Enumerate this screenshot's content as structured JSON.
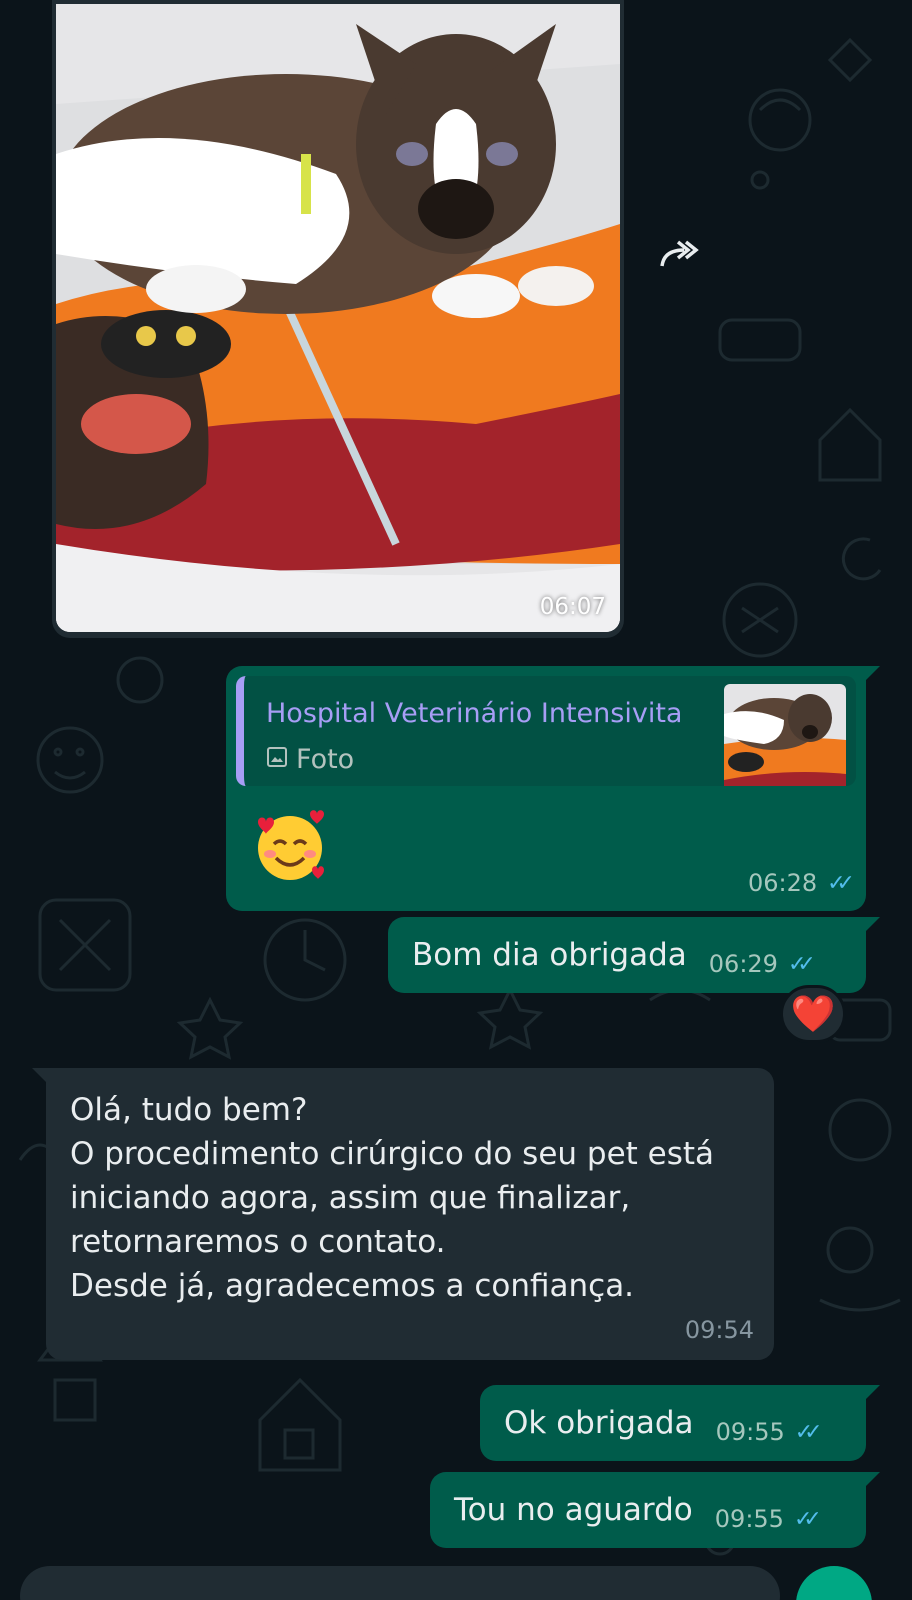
{
  "messages": {
    "image": {
      "time": "06:07"
    },
    "reply": {
      "quoted_author": "Hospital Veterinário Intensivita",
      "quoted_type": "Foto",
      "emoji": "smiling-face-with-hearts",
      "time": "06:28",
      "status": "read"
    },
    "bom_dia": {
      "text": "Bom dia obrigada",
      "time": "06:29",
      "status": "read",
      "reaction": "❤️"
    },
    "hospital": {
      "text": "Olá, tudo bem?\nO procedimento cirúrgico do seu pet está iniciando agora, assim que finalizar, retornaremos o contato.\nDesde já, agradecemos a confiança.",
      "time": "09:54"
    },
    "ok": {
      "text": "Ok obrigada",
      "time": "09:55",
      "status": "read"
    },
    "tou": {
      "text": "Tou no aguardo",
      "time": "09:55",
      "status": "read"
    }
  },
  "icons": {
    "forward": "forward-icon",
    "photo": "photo-icon",
    "read_ticks": "double-check-icon",
    "heart_reaction": "heart-icon"
  },
  "colors": {
    "background": "#0b141a",
    "outgoing_bubble": "#005c4b",
    "incoming_bubble": "#202c33",
    "quote_accent": "#a79ef5",
    "read_ticks": "#53bdeb",
    "send_button": "#00a884"
  }
}
